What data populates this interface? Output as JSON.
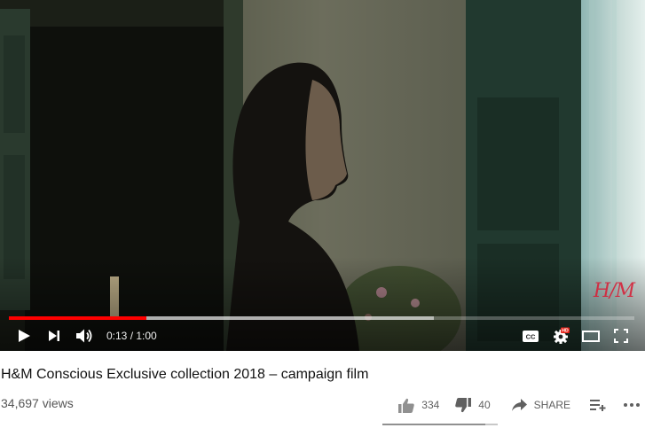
{
  "player": {
    "watermark": "H/M",
    "progress": {
      "played_fraction": 0.22,
      "buffered_fraction": 0.68
    },
    "time": {
      "current": "0:13",
      "separator": " / ",
      "duration": "1:00"
    },
    "icons": {
      "play": "play-icon",
      "next": "next-icon",
      "volume": "volume-icon",
      "captions": "captions-icon",
      "settings": "settings-gear-icon",
      "hd_badge": "HD",
      "theater": "theater-mode-icon",
      "fullscreen": "fullscreen-icon"
    },
    "colors": {
      "progress_played": "#ff0000",
      "hd_badge": "#e62117"
    }
  },
  "video": {
    "title": "H&M Conscious Exclusive collection 2018 – campaign film",
    "views": "34,697 views"
  },
  "actions": {
    "likes": "334",
    "dislikes": "40",
    "share_label": "SHARE",
    "icons": {
      "like": "thumbs-up-icon",
      "dislike": "thumbs-down-icon",
      "share": "share-arrow-icon",
      "save": "add-to-playlist-icon",
      "more": "more-horizontal-icon"
    }
  },
  "sentiment": {
    "like_fraction": 0.89
  }
}
